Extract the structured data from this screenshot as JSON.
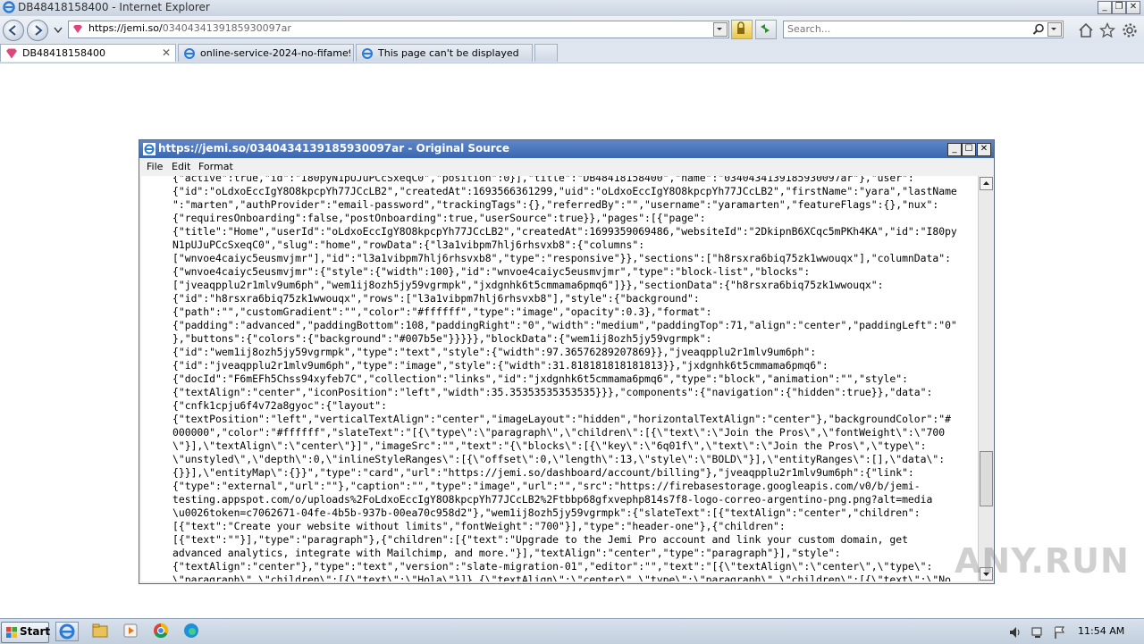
{
  "window": {
    "title": "DB48418158400 - Internet Explorer"
  },
  "address_bar": {
    "host": "https://jemi.so/",
    "path": "0340434139185930097ar"
  },
  "search": {
    "placeholder": "Search..."
  },
  "tabs": [
    {
      "label": "DB48418158400",
      "active": true
    },
    {
      "label": "online-service-2024-no-fifame9...",
      "active": false
    },
    {
      "label": "This page can't be displayed",
      "active": false
    }
  ],
  "source_window": {
    "title": "https://jemi.so/0340434139185930097ar - Original Source",
    "menu": [
      "File",
      "Edit",
      "Format"
    ],
    "lines": [
      "{\"active\":true,\"id\":\"I80pyN1pUJuPCcSxeqC0\",\"position\":0}],\"title\":\"DB48418158400\",\"name\":\"0340434139185930097ar\"},\"user\":",
      "{\"id\":\"oLdxoEccIgY8O8kpcpYh77JCcLB2\",\"createdAt\":1693566361299,\"uid\":\"oLdxoEccIgY8O8kpcpYh77JCcLB2\",\"firstName\":\"yara\",\"lastName",
      "\":\"marten\",\"authProvider\":\"email-password\",\"trackingTags\":{},\"referredBy\":\"\",\"username\":\"yaramarten\",\"featureFlags\":{},\"nux\":",
      "{\"requiresOnboarding\":false,\"postOnboarding\":true,\"userSource\":true}},\"pages\":[{\"page\":",
      "{\"title\":\"Home\",\"userId\":\"oLdxoEccIgY8O8kpcpYh77JCcLB2\",\"createdAt\":1699359069486,\"websiteId\":\"2DkipnB6XCqc5mPKh4KA\",\"id\":\"I80py",
      "N1pUJuPCcSxeqC0\",\"slug\":\"home\",\"rowData\":{\"l3a1vibpm7hlj6rhsvxb8\":{\"columns\":",
      "[\"wnvoe4caiyc5eusmvjmr\"],\"id\":\"l3a1vibpm7hlj6rhsvxb8\",\"type\":\"responsive\"}},\"sections\":[\"h8rsxra6biq75zk1wwouqx\"],\"columnData\":",
      "{\"wnvoe4caiyc5eusmvjmr\":{\"style\":{\"width\":100},\"id\":\"wnvoe4caiyc5eusmvjmr\",\"type\":\"block-list\",\"blocks\":",
      "[\"jveaqpplu2r1mlv9um6ph\",\"wem1ij8ozh5jy59vgrmpk\",\"jxdgnhk6t5cmmama6pmq6\"]}},\"sectionData\":{\"h8rsxra6biq75zk1wwouqx\":",
      "{\"id\":\"h8rsxra6biq75zk1wwouqx\",\"rows\":[\"l3a1vibpm7hlj6rhsvxb8\"],\"style\":{\"background\":",
      "{\"path\":\"\",\"customGradient\":\"\",\"color\":\"#ffffff\",\"type\":\"image\",\"opacity\":0.3},\"format\":",
      "{\"padding\":\"advanced\",\"paddingBottom\":108,\"paddingRight\":\"0\",\"width\":\"medium\",\"paddingTop\":71,\"align\":\"center\",\"paddingLeft\":\"0\"",
      "},\"buttons\":{\"colors\":{\"background\":\"#007b5e\"}}}}},\"blockData\":{\"wem1ij8ozh5jy59vgrmpk\":",
      "{\"id\":\"wem1ij8ozh5jy59vgrmpk\",\"type\":\"text\",\"style\":{\"width\":97.36576289207869}},\"jveaqpplu2r1mlv9um6ph\":",
      "{\"id\":\"jveaqpplu2r1mlv9um6ph\",\"type\":\"image\",\"style\":{\"width\":31.818181818181813}},\"jxdgnhk6t5cmmama6pmq6\":",
      "{\"docId\":\"F6mEFh5Chss94xyfeb7C\",\"collection\":\"links\",\"id\":\"jxdgnhk6t5cmmama6pmq6\",\"type\":\"block\",\"animation\":\"\",\"style\":",
      "{\"textAlign\":\"center\",\"iconPosition\":\"left\",\"width\":35.35353535353535}}},\"components\":{\"navigation\":{\"hidden\":true}},\"data\":",
      "{\"cnfk1cpju6f4v72a8gyoc\":{\"layout\":",
      "{\"textPosition\":\"left\",\"verticalTextAlign\":\"center\",\"imageLayout\":\"hidden\",\"horizontalTextAlign\":\"center\"},\"backgroundColor\":\"#",
      "000000\",\"color\":\"#ffffff\",\"slateText\":\"[{\\\"type\\\":\\\"paragraph\\\",\\\"children\\\":[{\\\"text\\\":\\\"Join the Pros\\\",\\\"fontWeight\\\":\\\"700",
      "\\\"}],\\\"textAlign\\\":\\\"center\\\"}]\",\"imageSrc\":\"\",\"text\":\"{\\\"blocks\\\":[{\\\"key\\\":\\\"6q01f\\\",\\\"text\\\":\\\"Join the Pros\\\",\\\"type\\\":",
      "\\\"unstyled\\\",\\\"depth\\\":0,\\\"inlineStyleRanges\\\":[{\\\"offset\\\":0,\\\"length\\\":13,\\\"style\\\":\\\"BOLD\\\"}],\\\"entityRanges\\\":[],\\\"data\\\":",
      "{}}],\\\"entityMap\\\":{}}\",\"type\":\"card\",\"url\":\"https://jemi.so/dashboard/account/billing\"},\"jveaqpplu2r1mlv9um6ph\":{\"link\":",
      "{\"type\":\"external\",\"url\":\"\"},\"caption\":\"\",\"type\":\"image\",\"url\":\"\",\"src\":\"https://firebasestorage.googleapis.com/v0/b/jemi-",
      "testing.appspot.com/o/uploads%2FoLdxoEccIgY8O8kpcpYh77JCcLB2%2Ftbbp68gfxvephp814s7f8-logo-correo-argentino-png.png?alt=media",
      "\\u0026token=c7062671-04fe-4b5b-937b-00ea70c958d2\"},\"wem1ij8ozh5jy59vgrmpk\":{\"slateText\":[{\"textAlign\":\"center\",\"children\":",
      "[{\"text\":\"Create your website without limits\",\"fontWeight\":\"700\"}],\"type\":\"header-one\"},{\"children\":",
      "[{\"text\":\"\"}],\"type\":\"paragraph\"},{\"children\":[{\"text\":\"Upgrade to the Jemi Pro account and link your custom domain, get",
      "advanced analytics, integrate with Mailchimp, and more.\"}],\"textAlign\":\"center\",\"type\":\"paragraph\"}],\"style\":",
      "{\"textAlign\":\"center\"},\"type\":\"text\",\"version\":\"slate-migration-01\",\"editor\":\"\",\"text\":\"[{\\\"textAlign\\\":\\\"center\\\",\\\"type\\\":",
      "\\\"paragraph\\\",\\\"children\\\":[{\\\"text\\\":\\\"Hola\\\"}]},{\\\"textAlign\\\":\\\"center\\\",\\\"type\\\":\\\"paragraph\\\",\\\"children\\\":[{\\\"text\\\":\\\"No"
    ]
  },
  "watermark": "ANY.RUN",
  "taskbar": {
    "start_label": "Start",
    "clock": "11:54 AM"
  },
  "colors": {
    "title_bar": "#3b67b0",
    "taskbar": "#c2cfdd"
  }
}
